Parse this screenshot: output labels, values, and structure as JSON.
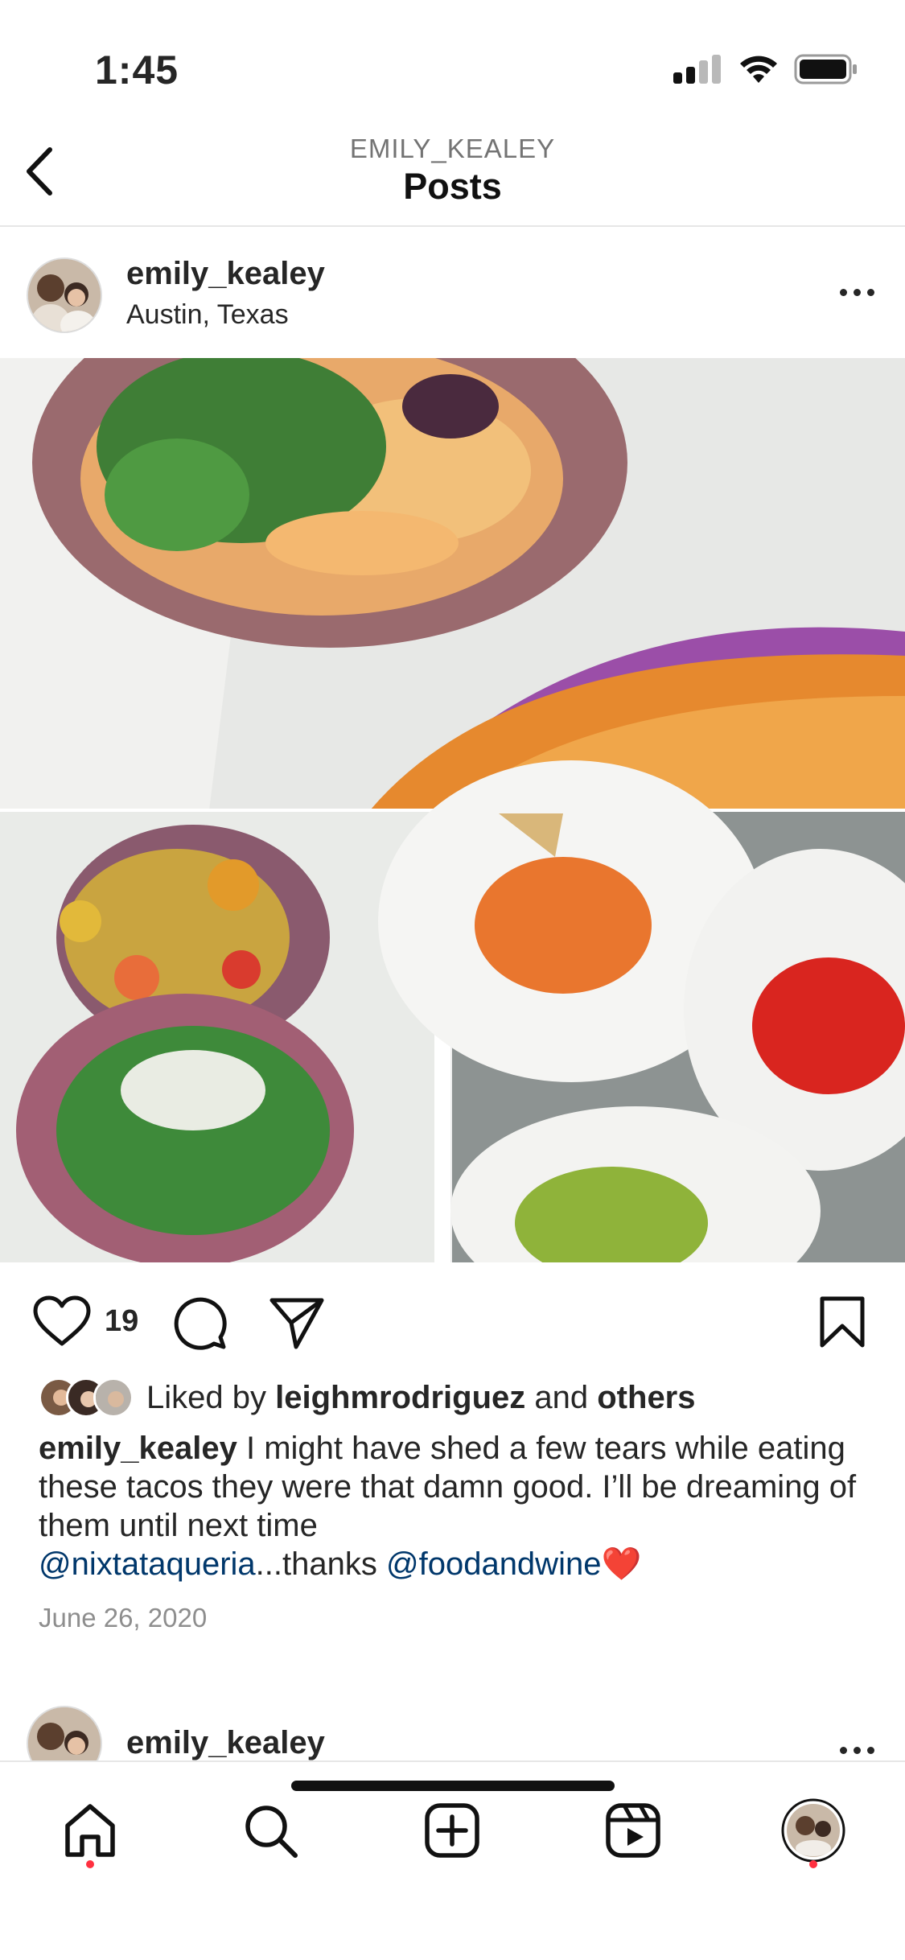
{
  "status_bar": {
    "time": "1:45"
  },
  "header": {
    "subtitle": "EMILY_KEALEY",
    "title": "Posts"
  },
  "post": {
    "username": "emily_kealey",
    "location": "Austin, Texas",
    "like_count": "19",
    "liked_by_prefix": "Liked by",
    "liked_by_user": "leighmrodriguez",
    "liked_by_and": "and",
    "liked_by_others": "others",
    "caption_user": "emily_kealey",
    "caption_text": "I might have shed a few tears while eating these tacos they were that damn good. I’ll be dreaming of them until next time",
    "caption_mention1": "@nixtataqueria",
    "caption_mid": "...thanks",
    "caption_mention2": "@foodandwine",
    "caption_emoji": "❤️",
    "date": "June 26, 2020"
  },
  "next_post": {
    "username": "emily_kealey"
  },
  "tabs": [
    "home-icon",
    "search-icon",
    "new-post-icon",
    "reels-icon",
    "profile-avatar"
  ],
  "colors": {
    "accent_dot": "#ff3040",
    "mention": "#00376b",
    "muted": "#8e8e8e"
  }
}
